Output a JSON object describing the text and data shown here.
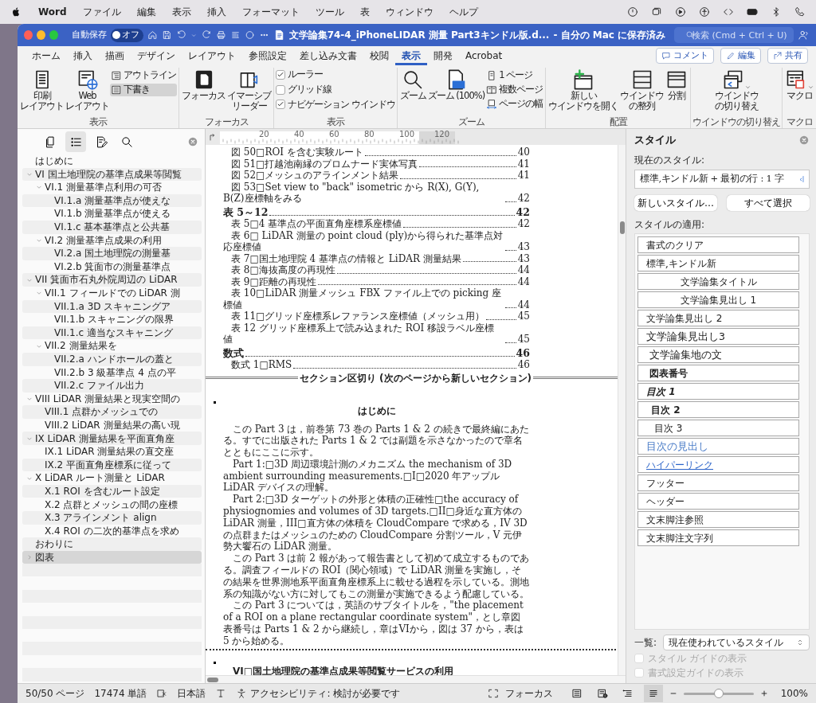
{
  "menubar": {
    "app": "Word",
    "menus": [
      "ファイル",
      "編集",
      "表示",
      "挿入",
      "フォーマット",
      "ツール",
      "表",
      "ウィンドウ",
      "ヘルプ"
    ]
  },
  "titlebar": {
    "autosave_label": "自動保存",
    "autosave": {
      "on": false,
      "label": "オフ"
    },
    "title": "文学論集74-4_iPhoneLIDAR 測量 Part3キンドル版.d...",
    "save_status": "- 自分の Mac に保存済み",
    "search": {
      "placeholder": "検索 (Cmd + Ctrl + U)"
    }
  },
  "ribbon_tabs": [
    {
      "label": "ホーム",
      "selected": false
    },
    {
      "label": "挿入",
      "selected": false
    },
    {
      "label": "描画",
      "selected": false
    },
    {
      "label": "デザイン",
      "selected": false
    },
    {
      "label": "レイアウト",
      "selected": false
    },
    {
      "label": "参照設定",
      "selected": false
    },
    {
      "label": "差し込み文書",
      "selected": false
    },
    {
      "label": "校閲",
      "selected": false
    },
    {
      "label": "表示",
      "selected": true
    },
    {
      "label": "開発",
      "selected": false
    },
    {
      "label": "Acrobat",
      "selected": false
    }
  ],
  "ribbon_actions": [
    "コメント",
    "編集",
    "共有"
  ],
  "ribbon_groups": [
    {
      "label": "表示",
      "items": [
        {
          "kind": "large",
          "label": [
            "印刷",
            "レイアウト"
          ],
          "selected": false
        },
        {
          "kind": "large",
          "label": [
            "Web",
            "レイアウト"
          ],
          "selected": false
        },
        {
          "kind": "small",
          "label": "アウトライン",
          "selected": false
        },
        {
          "kind": "small",
          "label": "下書き",
          "selected": true
        }
      ]
    },
    {
      "label": "フォーカス",
      "items": [
        {
          "kind": "large",
          "label": [
            "フォーカス"
          ]
        },
        {
          "kind": "large",
          "label": [
            "イマーシブ",
            "リーダー"
          ]
        }
      ]
    },
    {
      "label": "表示",
      "items": [
        {
          "kind": "check",
          "label": "ルーラー",
          "checked": true
        },
        {
          "kind": "check",
          "label": "グリッド線",
          "checked": false
        },
        {
          "kind": "check",
          "label": "ナビゲーション ウインドウ",
          "checked": true
        }
      ]
    },
    {
      "label": "ズーム",
      "items": [
        {
          "kind": "large",
          "label": [
            "ズーム"
          ]
        },
        {
          "kind": "large",
          "label": [
            "ズーム (100%)"
          ]
        },
        {
          "kind": "small",
          "label": "1 ページ"
        },
        {
          "kind": "small",
          "label": "複数ページ"
        },
        {
          "kind": "small",
          "label": "ページの幅"
        }
      ]
    },
    {
      "label": "配置",
      "items": [
        {
          "kind": "large",
          "label": [
            "新しい",
            "ウインドウを開く"
          ]
        },
        {
          "kind": "large",
          "label": [
            "ウインドウ",
            "の整列"
          ]
        },
        {
          "kind": "large",
          "label": [
            "分割"
          ]
        }
      ]
    },
    {
      "label": "ウインドウの切り替え",
      "items": [
        {
          "kind": "large",
          "label": [
            "ウインドウ",
            "の切り替え"
          ]
        }
      ]
    },
    {
      "label": "マクロ",
      "items": [
        {
          "kind": "large",
          "label": [
            "マクロ"
          ]
        }
      ]
    }
  ],
  "navigation": {
    "tabs": [
      {
        "selected": false
      },
      {
        "selected": true
      },
      {
        "selected": false
      },
      {
        "selected": false
      }
    ],
    "items": [
      {
        "label": "はじめに",
        "selected": false
      },
      {
        "label": "VI 国土地理院の基準点成果等閲覧",
        "selected": false,
        "expanded": true,
        "children": [
          {
            "label": "VI.1 測量基準点利用の可否",
            "selected": false,
            "expanded": true,
            "children": [
              {
                "label": "VI.1.a 測量基準点が使えな",
                "selected": false
              },
              {
                "label": "VI.1.b 測量基準点が使える",
                "selected": false
              },
              {
                "label": "VI.1.c 基本基準点と公共基",
                "selected": false
              }
            ]
          },
          {
            "label": "VI.2 測量基準点成果の利用",
            "selected": false,
            "expanded": true,
            "children": [
              {
                "label": "VI.2.a 国土地理院の測量基",
                "selected": false
              },
              {
                "label": "VI.2.b 箕面市の測量基準点",
                "selected": false
              }
            ]
          }
        ]
      },
      {
        "label": "VII 箕面市石丸外院周辺の LiDAR",
        "selected": false,
        "expanded": true,
        "children": [
          {
            "label": "VII.1 フィールドでの LiDAR 測",
            "selected": false,
            "expanded": true,
            "children": [
              {
                "label": "VII.1.a 3D スキャニングア",
                "selected": false
              },
              {
                "label": "VII.1.b スキャニングの限界",
                "selected": false
              },
              {
                "label": "VII.1.c 適当なスキャニング",
                "selected": false
              }
            ]
          },
          {
            "label": "VII.2 測量結果を",
            "selected": false,
            "expanded": true,
            "children": [
              {
                "label": "VII.2.a ハンドホールの蓋と",
                "selected": false
              },
              {
                "label": "VII.2.b 3 級基準点 4 点の平",
                "selected": false
              },
              {
                "label": "VII.2.c ファイル出力",
                "selected": false
              }
            ]
          }
        ]
      },
      {
        "label": "VIII LiDAR 測量結果と現実空間の",
        "selected": false,
        "expanded": true,
        "children": [
          {
            "label": "VIII.1 点群かメッシュでの",
            "selected": false
          },
          {
            "label": "VIII.2 LiDAR 測量結果の高い現",
            "selected": false
          }
        ]
      },
      {
        "label": "IX LiDAR 測量結果を平面直角座",
        "selected": false,
        "expanded": true,
        "children": [
          {
            "label": "IX.1 LiDAR 測量結果の直交座",
            "selected": false
          },
          {
            "label": "IX.2 平面直角座標系に従って",
            "selected": false
          }
        ]
      },
      {
        "label": "X LiDAR ルート測量と LiDAR",
        "selected": false,
        "expanded": true,
        "children": [
          {
            "label": "X.1 ROI を含むルート設定",
            "selected": false
          },
          {
            "label": "X.2 点群とメッシュの間の座標",
            "selected": false
          },
          {
            "label": "X.3 アラインメント align",
            "selected": false
          },
          {
            "label": "X.4 ROI の二次的基準点を求め",
            "selected": false
          }
        ]
      },
      {
        "label": "おわりに",
        "selected": false
      },
      {
        "label": "図表",
        "selected": true,
        "expanded": false
      }
    ]
  },
  "ruler": {
    "labels": [
      "20",
      "40",
      "60",
      "80",
      "100",
      "120"
    ]
  },
  "document": {
    "toc": [
      {
        "kind": "entry",
        "text": "図 50□ROI を含む実験ルート",
        "page": "40"
      },
      {
        "kind": "entry",
        "text": "図 51□打越池南縁のプロムナード実体写真",
        "page": "41"
      },
      {
        "kind": "entry",
        "text": "図 52□メッシュのアラインメント結果",
        "page": "41"
      },
      {
        "kind": "entry",
        "text": "図 53□Set view to \"back\" isometric から R(X), G(Y), B(Z)座標軸をみる",
        "page": "42"
      },
      {
        "kind": "heading",
        "text": "表 5～12",
        "page": "42"
      },
      {
        "kind": "entry",
        "text": "表 5□4 基準点の平面直角座標系座標値",
        "page": "42"
      },
      {
        "kind": "entry",
        "text": "表 6□ LiDAR 測量の point cloud (ply)から得られた基準点対応座標値",
        "page": "43"
      },
      {
        "kind": "entry",
        "text": "表 7□国土地理院 4 基準点の情報と LiDAR 測量結果",
        "page": "43"
      },
      {
        "kind": "entry",
        "text": "表 8□海抜高度の再現性",
        "page": "44"
      },
      {
        "kind": "entry",
        "text": "表 9□距離の再現性",
        "page": "44"
      },
      {
        "kind": "entry",
        "text": "表 10□LiDAR 測量メッシュ FBX ファイル上での picking 座標値",
        "page": "44"
      },
      {
        "kind": "entry",
        "text": "表 11□グリッド座標系レファランス座標値（メッシュ用）",
        "page": "45"
      },
      {
        "kind": "entry",
        "text": "表 12 グリッド座標系上で読み込まれた ROI 移設ラベル座標値",
        "page": "45"
      },
      {
        "kind": "heading",
        "text": "数式",
        "page": "46"
      },
      {
        "kind": "entry",
        "text": "数式 1□RMS",
        "page": "46"
      }
    ],
    "section_break": "セクション区切り (次のページから新しいセクション)",
    "heading": "はじめに",
    "paragraphs": [
      "この Part 3 は，前巻第 73 巻の Parts 1 & 2 の続きで最終編にあたる。すでに出版された Parts 1 & 2 では副題を示さなかったので章名とともにここに示す。",
      "Part 1:□3D 周辺環境計測のメカニズム the mechanism of 3D ambient surrounding measurements.□I□2020 年アップル LiDAR デバイスの理解。",
      "Part 2:□3D ターゲットの外形と体積の正確性□the accuracy of physiognomies and volumes of 3D targets.□II□身近な直方体の LiDAR 測量，III□直方体の体積を CloudCompare で求める，IV 3D の点群またはメッシュのための CloudCompare 分割ツール，V 元伊勢大饗石の LiDAR 測量。",
      "この Part 3 は前 2 報があって報告書として初めて成立するものである。調査フィールドの ROI（関心領域）で LiDAR 測量を実施し，その結果を世界測地系平面直角座標系上に載せる過程を示している。測地系の知識がない方に対してもこの測量が実施できるよう配慮している。",
      "この Part 3 については，英語のサブタイトルを，\"the placement of a ROI on a plane rectangular coordinate system\"，とし章図表番号は Parts 1 & 2 から継続し，章はVIから，図は 37 から，表は 5 から始める。"
    ],
    "next_heading": "VI□国土地理院の基準点成果等閲覧サービスの利用"
  },
  "styles_pane": {
    "title": "スタイル",
    "current_label": "現在のスタイル:",
    "current": "標準,キンドル新 + 最初の行 : 1 字",
    "buttons": [
      "新しいスタイル…",
      "すべて選択"
    ],
    "apply_label": "スタイルの適用:",
    "styles": [
      {
        "name": "書式のクリア",
        "kind": "clear"
      },
      {
        "name": "標準,キンドル新",
        "kind": "normal"
      },
      {
        "name": "文学論集タイトル",
        "kind": "title"
      },
      {
        "name": "文学論集見出し 1",
        "kind": "heading1"
      },
      {
        "name": "文学論集見出し 2",
        "kind": "heading2"
      },
      {
        "name": "文学論集見出し3",
        "kind": "heading3"
      },
      {
        "name": "文学論集地の文",
        "kind": "body"
      },
      {
        "name": "図表番号",
        "kind": "caption"
      },
      {
        "name": "目次 1",
        "kind": "toc1"
      },
      {
        "name": "目次 2",
        "kind": "toc2"
      },
      {
        "name": "目次 3",
        "kind": "toc3"
      },
      {
        "name": "目次の見出し",
        "kind": "toc_heading"
      },
      {
        "name": "ハイパーリンク",
        "kind": "hyperlink"
      },
      {
        "name": "フッター",
        "kind": "normal"
      },
      {
        "name": "ヘッダー",
        "kind": "normal"
      },
      {
        "name": "文末脚注参照",
        "kind": "normal"
      },
      {
        "name": "文末脚注文字列",
        "kind": "normal"
      }
    ],
    "list_label": "一覧:",
    "list_value": "現在使われているスタイル",
    "options": [
      {
        "label": "スタイル ガイドの表示",
        "checked": false,
        "disabled": true
      },
      {
        "label": "書式設定ガイドの表示",
        "checked": false,
        "disabled": true
      }
    ]
  },
  "status_bar": {
    "page": "50/50 ページ",
    "words": "17474 単語",
    "language": "日本語",
    "accessibility": "アクセシビリティ: 検討が必要です",
    "focus": "フォーカス",
    "views": [
      {
        "selected": false
      },
      {
        "selected": false
      },
      {
        "selected": false
      },
      {
        "selected": true
      }
    ],
    "zoom": {
      "level": 0.5,
      "reading": "100%"
    }
  }
}
